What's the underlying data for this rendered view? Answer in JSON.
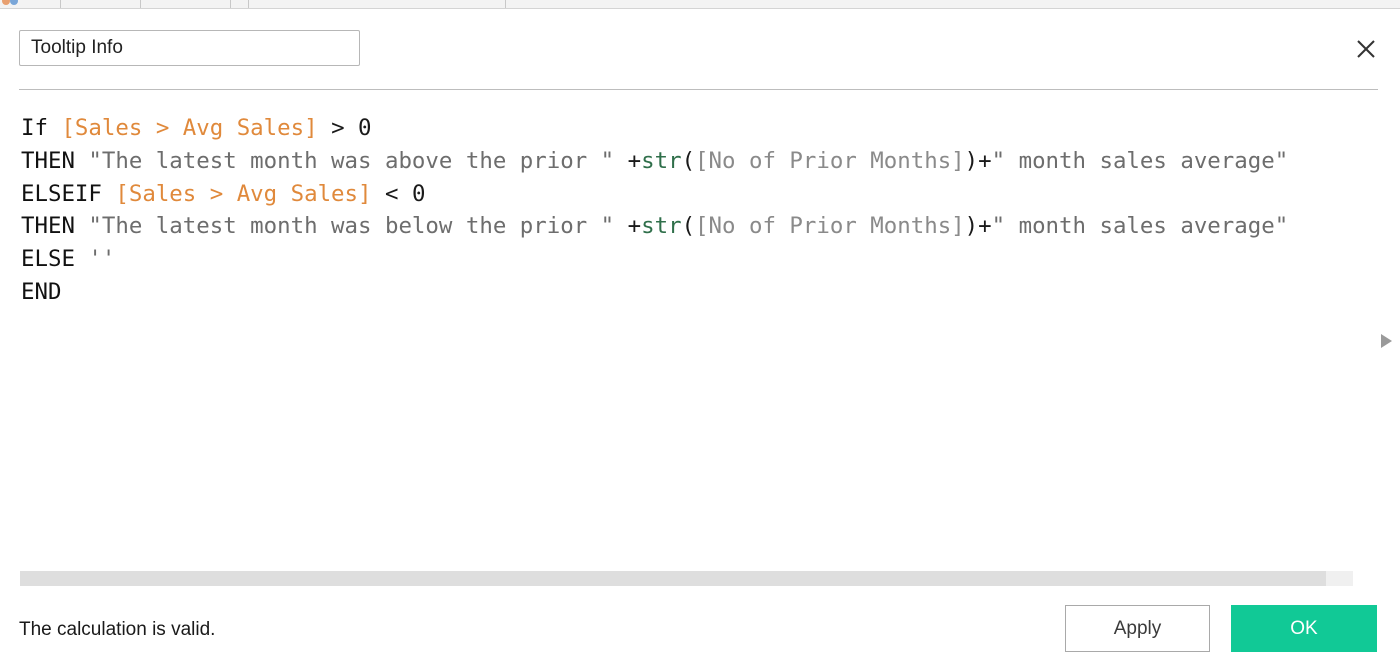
{
  "dialog": {
    "calculation_name": "Tooltip Info",
    "colors": {
      "field": "#e0893b",
      "parameter": "#8a8a8a",
      "function": "#2f6f4a",
      "string": "#6d6d6d",
      "ok_button": "#11c996"
    }
  },
  "editor": {
    "lines": [
      [
        {
          "type": "kw",
          "text": "If "
        },
        {
          "type": "field",
          "text": "[Sales > Avg Sales]"
        },
        {
          "type": "plain",
          "text": " > 0"
        }
      ],
      [
        {
          "type": "kw",
          "text": "THEN "
        },
        {
          "type": "str",
          "text": "\"The latest month was above the prior \""
        },
        {
          "type": "plain",
          "text": " +"
        },
        {
          "type": "func",
          "text": "str"
        },
        {
          "type": "plain",
          "text": "("
        },
        {
          "type": "param",
          "text": "[No of Prior Months]"
        },
        {
          "type": "plain",
          "text": ")+"
        },
        {
          "type": "str",
          "text": "\" month sales average\""
        }
      ],
      [
        {
          "type": "kw",
          "text": "ELSEIF "
        },
        {
          "type": "field",
          "text": "[Sales > Avg Sales]"
        },
        {
          "type": "plain",
          "text": " < 0"
        }
      ],
      [
        {
          "type": "kw",
          "text": "THEN "
        },
        {
          "type": "str",
          "text": "\"The latest month was below the prior \""
        },
        {
          "type": "plain",
          "text": " +"
        },
        {
          "type": "func",
          "text": "str"
        },
        {
          "type": "plain",
          "text": "("
        },
        {
          "type": "param",
          "text": "[No of Prior Months]"
        },
        {
          "type": "plain",
          "text": ")+"
        },
        {
          "type": "str",
          "text": "\" month sales average\""
        }
      ],
      [
        {
          "type": "kw",
          "text": "ELSE "
        },
        {
          "type": "str",
          "text": "''"
        }
      ],
      [
        {
          "type": "kw",
          "text": "END"
        }
      ]
    ]
  },
  "status": {
    "message": "The calculation is valid."
  },
  "buttons": {
    "apply_label": "Apply",
    "ok_label": "OK"
  }
}
